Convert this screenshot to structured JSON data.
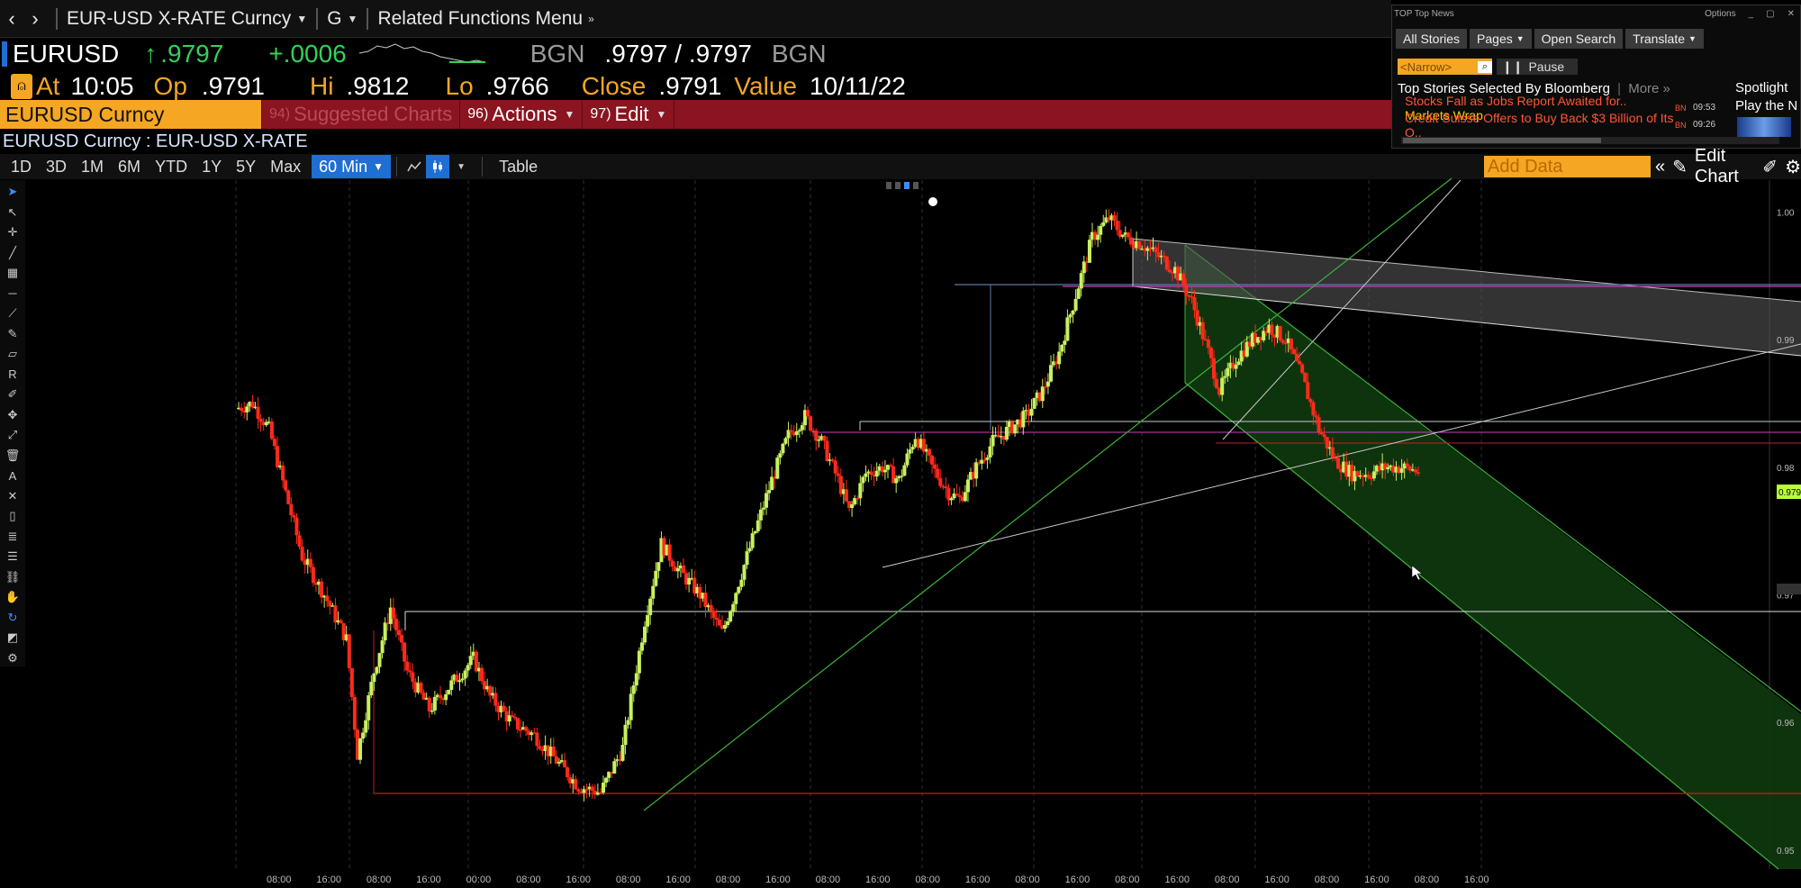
{
  "nav": {
    "security_menu": "EUR-USD X-RATE Curncy",
    "graph_menu": "G",
    "related_menu": "Related Functions Menu"
  },
  "quote": {
    "ticker": "EURUSD",
    "last": ".9797",
    "change": "+.0006",
    "source1": "BGN",
    "bid_ask": ".9797 / .9797",
    "source2": "BGN",
    "at_label": "At",
    "at_time": "10:05",
    "open_label": "Op",
    "open": ".9791",
    "high_label": "Hi",
    "high": ".9812",
    "low_label": "Lo",
    "low": ".9766",
    "close_label": "Close",
    "close": ".9791",
    "value_label": "Value",
    "value_date": "10/11/22"
  },
  "band": {
    "security": "EURUSD Curncy",
    "suggested_num": "94)",
    "suggested": "Suggested Charts",
    "actions_num": "96)",
    "actions": "Actions",
    "edit_num": "97)",
    "edit": "Edit"
  },
  "chart_header": {
    "title": "EURUSD Curncy : EUR-USD X-RATE"
  },
  "toolbar": {
    "timeframes": [
      "1D",
      "3D",
      "1M",
      "6M",
      "YTD",
      "1Y",
      "5Y",
      "Max"
    ],
    "interval": "60 Min",
    "table": "Table",
    "add_data_placeholder": "Add Data",
    "edit_chart": "Edit Chart"
  },
  "news": {
    "window_title": "TOP Top News",
    "options": "Options",
    "tabs": [
      "All Stories",
      "Pages",
      "Open Search",
      "Translate"
    ],
    "narrow": "<Narrow>",
    "pause": "Pause",
    "heading": "Top Stories Selected By Bloomberg",
    "more": "More »",
    "spotlight_1": "Spotlight",
    "spotlight_2": "Play the N",
    "items": [
      {
        "text": "Stocks Fall as Jobs Report Awaited for..",
        "tag": "Markets Wrap",
        "src": "BN",
        "time": "09:53"
      },
      {
        "text": "Credit Suisse Offers to Buy Back $3 Billion of Its O..",
        "tag": "",
        "src": "BN",
        "time": "09:26"
      }
    ]
  },
  "colors": {
    "up_candle": "#c8f060",
    "down_candle": "#ff2a1a",
    "accent_orange": "#f5a623",
    "band_red": "#8a1420",
    "quote_green": "#33d15a",
    "channel_fill": "#0f3a0f"
  },
  "chart_data": {
    "type": "candlestick",
    "interval": "60 Min",
    "ylim": [
      0.9485,
      1.0025
    ],
    "y_ticks": [
      "1.00",
      "0.99",
      "0.98",
      "0.97",
      "0.96",
      "0.95"
    ],
    "last_price_tag": "0.979",
    "x_ticks": [
      "08:00",
      "16:00",
      "08:00",
      "16:00",
      "00:00",
      "08:00",
      "16:00",
      "08:00",
      "16:00",
      "08:00",
      "16:00",
      "08:00",
      "16:00",
      "08:00",
      "16:00",
      "08:00",
      "16:00",
      "08:00",
      "16:00",
      "08:00",
      "16:00",
      "08:00",
      "16:00",
      "08:00",
      "16:00"
    ],
    "path_points": [
      [
        0,
        0.9846
      ],
      [
        3,
        0.985
      ],
      [
        6,
        0.983
      ],
      [
        9,
        0.978
      ],
      [
        12,
        0.973
      ],
      [
        16,
        0.97
      ],
      [
        20,
        0.9665
      ],
      [
        22,
        0.9575
      ],
      [
        25,
        0.964
      ],
      [
        28,
        0.969
      ],
      [
        31,
        0.964
      ],
      [
        35,
        0.961
      ],
      [
        39,
        0.963
      ],
      [
        43,
        0.965
      ],
      [
        46,
        0.962
      ],
      [
        50,
        0.96
      ],
      [
        54,
        0.959
      ],
      [
        58,
        0.957
      ],
      [
        62,
        0.955
      ],
      [
        66,
        0.9545
      ],
      [
        70,
        0.958
      ],
      [
        74,
        0.968
      ],
      [
        77,
        0.974
      ],
      [
        80,
        0.972
      ],
      [
        84,
        0.97
      ],
      [
        88,
        0.967
      ],
      [
        91,
        0.971
      ],
      [
        94,
        0.975
      ],
      [
        97,
        0.979
      ],
      [
        100,
        0.9825
      ],
      [
        103,
        0.984
      ],
      [
        106,
        0.982
      ],
      [
        109,
        0.979
      ],
      [
        111,
        0.9765
      ],
      [
        114,
        0.9795
      ],
      [
        117,
        0.98
      ],
      [
        120,
        0.979
      ],
      [
        123,
        0.9825
      ],
      [
        126,
        0.98
      ],
      [
        129,
        0.978
      ],
      [
        131,
        0.9775
      ],
      [
        134,
        0.98
      ],
      [
        137,
        0.982
      ],
      [
        140,
        0.983
      ],
      [
        143,
        0.984
      ],
      [
        146,
        0.986
      ],
      [
        149,
        0.989
      ],
      [
        152,
        0.9935
      ],
      [
        155,
        0.998
      ],
      [
        158,
        0.9995
      ],
      [
        161,
        0.998
      ],
      [
        164,
        0.9975
      ],
      [
        167,
        0.9965
      ],
      [
        170,
        0.9955
      ],
      [
        173,
        0.993
      ],
      [
        176,
        0.989
      ],
      [
        178,
        0.986
      ],
      [
        181,
        0.9885
      ],
      [
        184,
        0.99
      ],
      [
        187,
        0.991
      ],
      [
        190,
        0.99
      ],
      [
        193,
        0.987
      ],
      [
        196,
        0.983
      ],
      [
        199,
        0.9805
      ],
      [
        202,
        0.9795
      ],
      [
        205,
        0.9795
      ],
      [
        208,
        0.98
      ],
      [
        211,
        0.98
      ],
      [
        214,
        0.9797
      ]
    ]
  }
}
